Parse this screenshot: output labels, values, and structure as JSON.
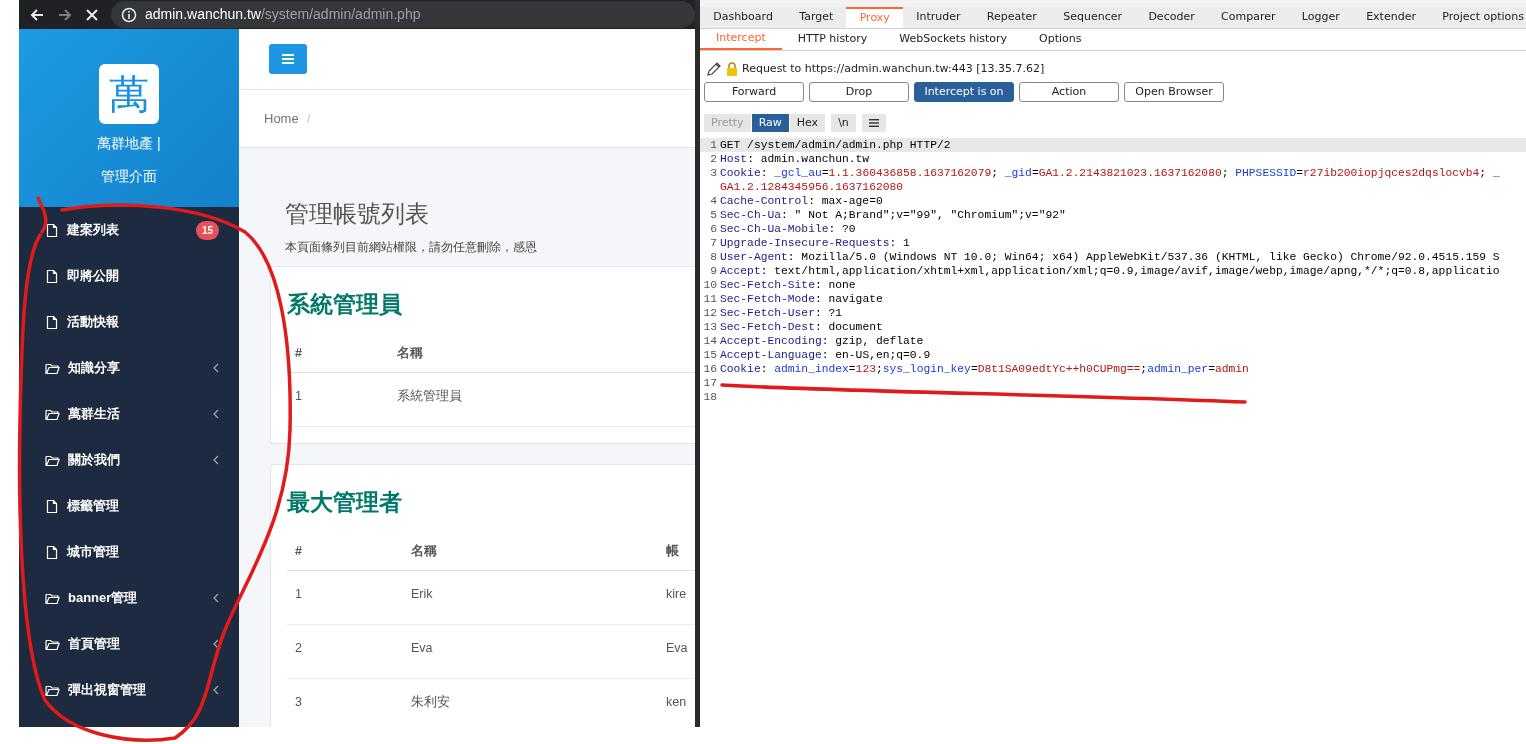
{
  "browser": {
    "nav": [
      {
        "kind": "back",
        "disabled": false
      },
      {
        "kind": "forward",
        "disabled": true
      },
      {
        "kind": "stop",
        "disabled": false
      }
    ],
    "url": {
      "host": "admin.wanchun.tw",
      "path": "/system/admin/admin.php"
    }
  },
  "sidebar": {
    "logo_char": "萬",
    "brand": "萬群地產 |",
    "subtitle": "管理介面",
    "items": [
      {
        "label": "建案列表",
        "kind": "page",
        "badge": "15"
      },
      {
        "label": "即將公開",
        "kind": "page"
      },
      {
        "label": "活動快報",
        "kind": "page"
      },
      {
        "label": "知識分享",
        "kind": "folder"
      },
      {
        "label": "萬群生活",
        "kind": "folder"
      },
      {
        "label": "關於我們",
        "kind": "folder"
      },
      {
        "label": "標籤管理",
        "kind": "page"
      },
      {
        "label": "城市管理",
        "kind": "page"
      },
      {
        "label": "banner管理",
        "kind": "folder"
      },
      {
        "label": "首頁管理",
        "kind": "folder"
      },
      {
        "label": "彈出視窗管理",
        "kind": "folder"
      }
    ]
  },
  "breadcrumb": {
    "items": [
      "Home"
    ],
    "separator": "/"
  },
  "page": {
    "title": "管理帳號列表",
    "subtitle": "本頁面條列目前網站權限，請勿任意刪除，感恩"
  },
  "cards": [
    {
      "title": "系統管理員",
      "columns": [
        "#",
        "名稱"
      ],
      "rows": [
        [
          "1",
          "系統管理員"
        ]
      ]
    },
    {
      "title": "最大管理者",
      "columns": [
        "#",
        "名稱",
        "帳"
      ],
      "rows": [
        [
          "1",
          "Erik",
          "kire"
        ],
        [
          "2",
          "Eva",
          "Eva"
        ],
        [
          "3",
          "朱利安",
          "ken"
        ]
      ]
    }
  ],
  "burp": {
    "tabs": [
      {
        "label": "Dashboard",
        "selected": false
      },
      {
        "label": "Target",
        "selected": false
      },
      {
        "label": "Proxy",
        "selected": true
      },
      {
        "label": "Intruder",
        "selected": false
      },
      {
        "label": "Repeater",
        "selected": false
      },
      {
        "label": "Sequencer",
        "selected": false
      },
      {
        "label": "Decoder",
        "selected": false
      },
      {
        "label": "Comparer",
        "selected": false
      },
      {
        "label": "Logger",
        "selected": false
      },
      {
        "label": "Extender",
        "selected": false
      },
      {
        "label": "Project options",
        "selected": false
      }
    ],
    "subtabs": [
      {
        "label": "Intercept",
        "selected": true
      },
      {
        "label": "HTTP history",
        "selected": false
      },
      {
        "label": "WebSockets history",
        "selected": false
      },
      {
        "label": "Options",
        "selected": false
      }
    ],
    "request_info": "Request to https://admin.wanchun.tw:443 [13.35.7.62]",
    "buttons": [
      {
        "label": "Forward",
        "active": false
      },
      {
        "label": "Drop",
        "active": false
      },
      {
        "label": "Intercept is on",
        "active": true
      },
      {
        "label": "Action",
        "active": false
      },
      {
        "label": "Open Browser",
        "active": false
      }
    ],
    "view_tabs": [
      {
        "kind": "text",
        "label": "Pretty",
        "selected": false,
        "disabled": true
      },
      {
        "kind": "text",
        "label": "Raw",
        "selected": true,
        "disabled": false
      },
      {
        "kind": "text",
        "label": "Hex",
        "selected": false,
        "disabled": false
      },
      {
        "kind": "text",
        "label": "\\n",
        "selected": false,
        "disabled": false
      },
      {
        "kind": "menu",
        "selected": false,
        "disabled": false
      }
    ],
    "lines": [
      {
        "number": "1",
        "segments": [
          {
            "kind": "plain",
            "text": "GET /system/admin/admin.php HTTP/2"
          }
        ]
      },
      {
        "number": "2",
        "segments": [
          {
            "kind": "name",
            "text": "Host"
          },
          {
            "kind": "plain",
            "text": ": admin.wanchun.tw"
          }
        ]
      },
      {
        "number": "3",
        "segments": [
          {
            "kind": "name",
            "text": "Cookie"
          },
          {
            "kind": "plain",
            "text": ": "
          },
          {
            "kind": "cname",
            "text": "_gcl_au"
          },
          {
            "kind": "plain",
            "text": "="
          },
          {
            "kind": "cval",
            "text": "1.1.360436858.1637162079"
          },
          {
            "kind": "plain",
            "text": "; "
          },
          {
            "kind": "cname",
            "text": "_gid"
          },
          {
            "kind": "plain",
            "text": "="
          },
          {
            "kind": "cval",
            "text": "GA1.2.2143821023.1637162080"
          },
          {
            "kind": "plain",
            "text": "; "
          },
          {
            "kind": "cname",
            "text": "PHPSESSID"
          },
          {
            "kind": "plain",
            "text": "="
          },
          {
            "kind": "cval",
            "text": "r27ib200iopjqces2dqslocvb4"
          },
          {
            "kind": "plain",
            "text": "; "
          },
          {
            "kind": "cname",
            "text": "_"
          }
        ],
        "wrapped": [
          {
            "kind": "cval",
            "text": "GA1.2.1284345956.1637162080"
          }
        ]
      },
      {
        "number": "4",
        "segments": [
          {
            "kind": "name",
            "text": "Cache-Control"
          },
          {
            "kind": "plain",
            "text": ": max-age=0"
          }
        ]
      },
      {
        "number": "5",
        "segments": [
          {
            "kind": "name",
            "text": "Sec-Ch-Ua"
          },
          {
            "kind": "plain",
            "text": ": \" Not A;Brand\";v=\"99\", \"Chromium\";v=\"92\""
          }
        ]
      },
      {
        "number": "6",
        "segments": [
          {
            "kind": "name",
            "text": "Sec-Ch-Ua-Mobile"
          },
          {
            "kind": "plain",
            "text": ": ?0"
          }
        ]
      },
      {
        "number": "7",
        "segments": [
          {
            "kind": "name",
            "text": "Upgrade-Insecure-Requests"
          },
          {
            "kind": "plain",
            "text": ": 1"
          }
        ]
      },
      {
        "number": "8",
        "segments": [
          {
            "kind": "name",
            "text": "User-Agent"
          },
          {
            "kind": "plain",
            "text": ": Mozilla/5.0 (Windows NT 10.0; Win64; x64) AppleWebKit/537.36 (KHTML, like Gecko) Chrome/92.0.4515.159 S"
          }
        ]
      },
      {
        "number": "9",
        "segments": [
          {
            "kind": "name",
            "text": "Accept"
          },
          {
            "kind": "plain",
            "text": ": text/html,application/xhtml+xml,application/xml;q=0.9,image/avif,image/webp,image/apng,*/*;q=0.8,applicatio"
          }
        ]
      },
      {
        "number": "10",
        "segments": [
          {
            "kind": "name",
            "text": "Sec-Fetch-Site"
          },
          {
            "kind": "plain",
            "text": ": none"
          }
        ]
      },
      {
        "number": "11",
        "segments": [
          {
            "kind": "name",
            "text": "Sec-Fetch-Mode"
          },
          {
            "kind": "plain",
            "text": ": navigate"
          }
        ]
      },
      {
        "number": "12",
        "segments": [
          {
            "kind": "name",
            "text": "Sec-Fetch-User"
          },
          {
            "kind": "plain",
            "text": ": ?1"
          }
        ]
      },
      {
        "number": "13",
        "segments": [
          {
            "kind": "name",
            "text": "Sec-Fetch-Dest"
          },
          {
            "kind": "plain",
            "text": ": document"
          }
        ]
      },
      {
        "number": "14",
        "segments": [
          {
            "kind": "name",
            "text": "Accept-Encoding"
          },
          {
            "kind": "plain",
            "text": ": gzip, deflate"
          }
        ]
      },
      {
        "number": "15",
        "segments": [
          {
            "kind": "name",
            "text": "Accept-Language"
          },
          {
            "kind": "plain",
            "text": ": en-US,en;q=0.9"
          }
        ]
      },
      {
        "number": "16",
        "segments": [
          {
            "kind": "name",
            "text": "Cookie"
          },
          {
            "kind": "plain",
            "text": ": "
          },
          {
            "kind": "cname",
            "text": "admin_index"
          },
          {
            "kind": "plain",
            "text": "="
          },
          {
            "kind": "cval",
            "text": "123"
          },
          {
            "kind": "plain",
            "text": ";"
          },
          {
            "kind": "cname",
            "text": "sys_login_key"
          },
          {
            "kind": "plain",
            "text": "="
          },
          {
            "kind": "cval",
            "text": "D8t1SA09edtYc++h0CUPmg=="
          },
          {
            "kind": "plain",
            "text": ";"
          },
          {
            "kind": "cname",
            "text": "admin_per"
          },
          {
            "kind": "plain",
            "text": "="
          },
          {
            "kind": "cval",
            "text": "admin"
          }
        ]
      },
      {
        "number": "17"
      },
      {
        "number": "18"
      }
    ]
  }
}
